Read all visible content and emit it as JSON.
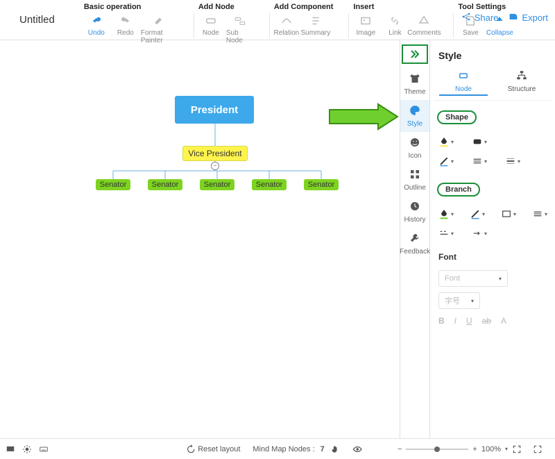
{
  "title": "Untitled",
  "toolbar": {
    "groups": {
      "basic": {
        "title": "Basic operation",
        "undo": "Undo",
        "redo": "Redo",
        "format_painter": "Format Painter"
      },
      "add_node": {
        "title": "Add Node",
        "node": "Node",
        "sub_node": "Sub Node"
      },
      "add_component": {
        "title": "Add Component",
        "relation": "Relation",
        "summary": "Summary"
      },
      "insert": {
        "title": "Insert",
        "image": "Image",
        "link": "Link",
        "comments": "Comments"
      },
      "tool_settings": {
        "title": "Tool Settings",
        "save": "Save",
        "collapse": "Collapse"
      }
    },
    "share": "Share",
    "export": "Export"
  },
  "mindmap": {
    "president": "President",
    "vice_president": "Vice President",
    "senators": [
      "Senator",
      "Senator",
      "Senator",
      "Senator",
      "Senator"
    ]
  },
  "side": {
    "theme": "Theme",
    "style": "Style",
    "icon": "Icon",
    "outline": "Outline",
    "history": "History",
    "feedback": "Feedback"
  },
  "panel": {
    "title": "Style",
    "tabs": {
      "node": "Node",
      "structure": "Structure"
    },
    "shape": "Shape",
    "branch": "Branch",
    "font": "Font",
    "font_placeholder": "Font",
    "size_placeholder": "字号"
  },
  "bottom": {
    "reset_layout": "Reset layout",
    "mindmap_nodes_label": "Mind Map Nodes :",
    "mindmap_nodes_count": "7",
    "zoom_text": "100%"
  }
}
